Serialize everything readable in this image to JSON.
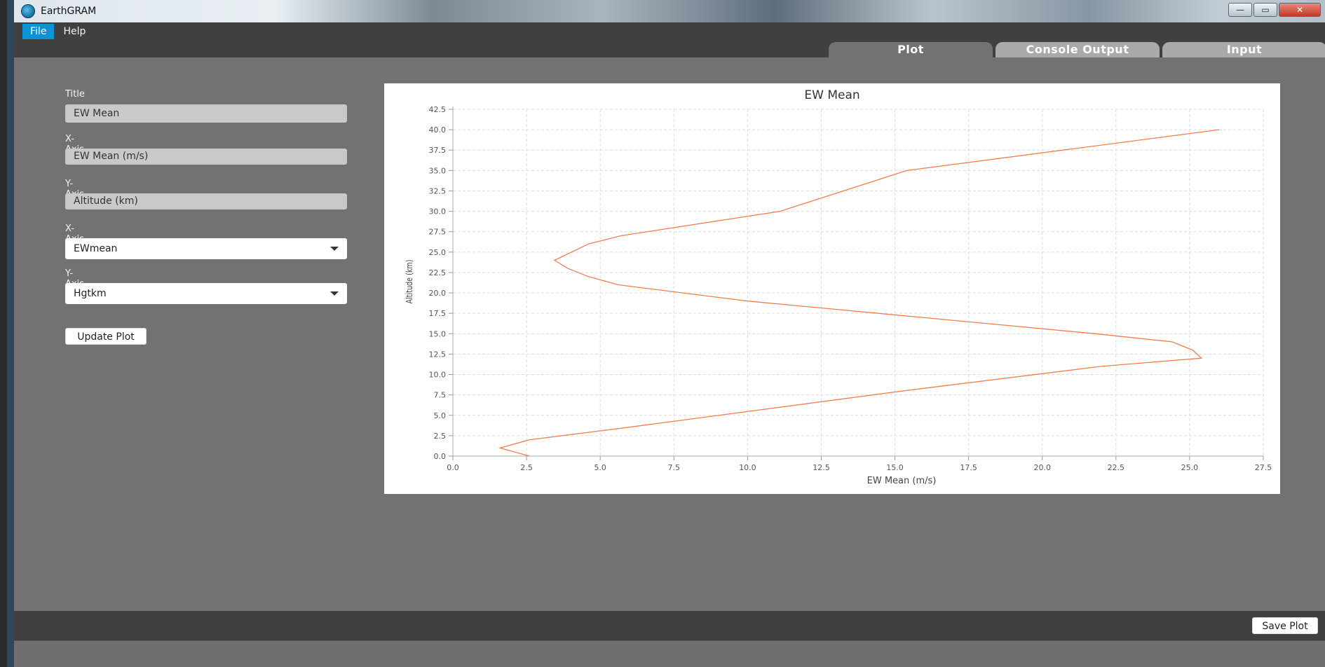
{
  "window": {
    "title": "EarthGRAM",
    "controls": {
      "minimize": "—",
      "maximize": "▭",
      "close": "✕"
    }
  },
  "menu": [
    {
      "label": "File",
      "active": true
    },
    {
      "label": "Help",
      "active": false
    }
  ],
  "tabs": [
    {
      "label": "Plot",
      "selected": true
    },
    {
      "label": "Console Output",
      "selected": false
    },
    {
      "label": "Input",
      "selected": false
    }
  ],
  "form": {
    "title_label": "Title",
    "title_value": "EW Mean",
    "xlabel_label": "X-Axis Label",
    "xlabel_value": "EW Mean (m/s)",
    "ylabel_label": "Y-Axis Label",
    "ylabel_value": "Altitude (km)",
    "xaxis_label": "X-Axis",
    "xaxis_value": "EWmean",
    "yaxis_label": "Y-Axis",
    "yaxis_value": "Hgtkm",
    "update_button": "Update Plot"
  },
  "footer": {
    "save_button": "Save Plot"
  },
  "colors": {
    "series": "#f07e4f",
    "accent": "#0b93d6"
  },
  "chart_data": {
    "type": "line",
    "title": "EW Mean",
    "xlabel": "EW Mean (m/s)",
    "ylabel": "Altitude (km)",
    "xlim": [
      0,
      27.5
    ],
    "ylim": [
      0,
      42.5
    ],
    "xticks": [
      "0.0",
      "2.5",
      "5.0",
      "7.5",
      "10.0",
      "12.5",
      "15.0",
      "17.5",
      "20.0",
      "22.5",
      "25.0",
      "27.5"
    ],
    "yticks": [
      "0.0",
      "2.5",
      "5.0",
      "7.5",
      "10.0",
      "12.5",
      "15.0",
      "17.5",
      "20.0",
      "22.5",
      "25.0",
      "27.5",
      "30.0",
      "32.5",
      "35.0",
      "37.5",
      "40.0",
      "42.5"
    ],
    "grid": true,
    "series": [
      {
        "x": [
          2.6,
          1.6,
          2.6,
          5.9,
          15.3,
          22.0,
          25.4,
          25.1,
          24.4,
          21.8,
          10.0,
          5.6,
          4.6,
          3.9,
          3.45,
          4.6,
          5.7,
          11.1,
          15.4,
          26.0
        ],
        "y": [
          0,
          1,
          2,
          3.5,
          8,
          11,
          12,
          13,
          14,
          15,
          19,
          21,
          22,
          23,
          24,
          26,
          27,
          30,
          35,
          40
        ]
      }
    ]
  }
}
